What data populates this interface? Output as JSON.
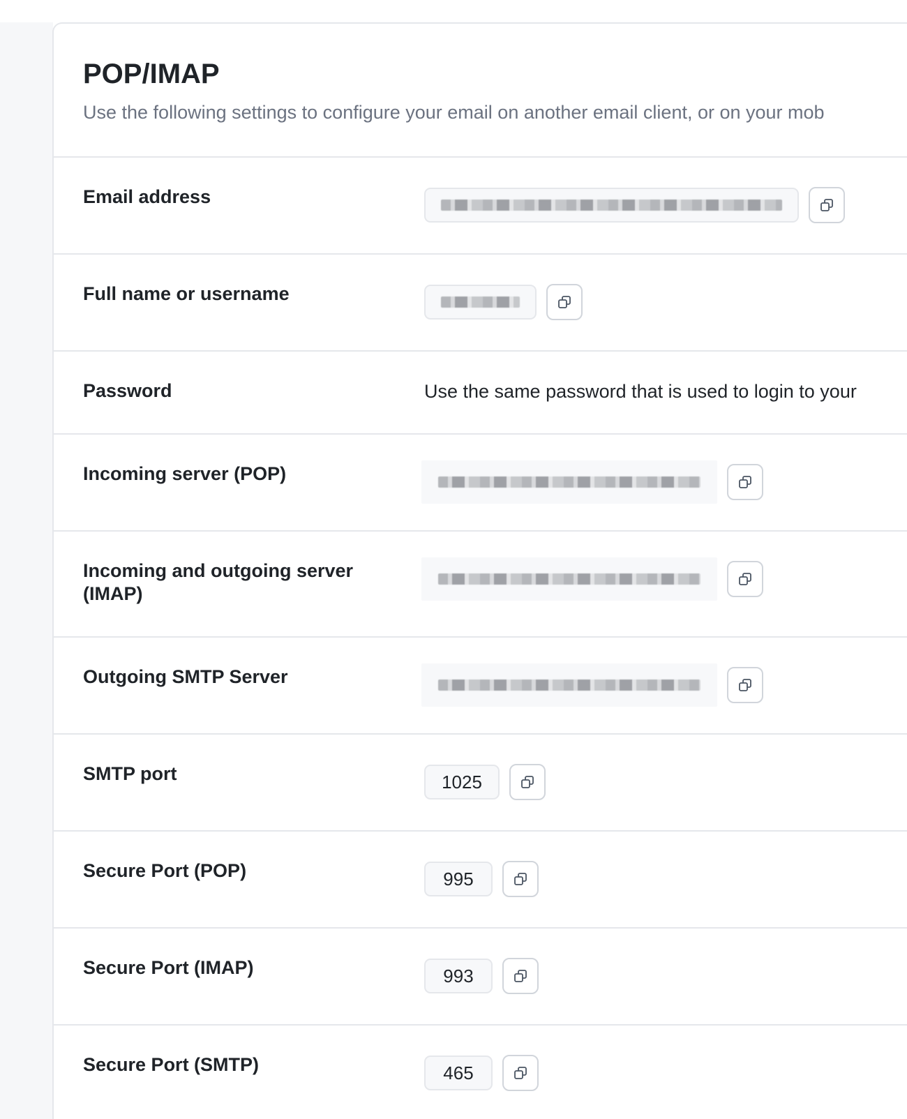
{
  "header": {
    "title": "POP/IMAP",
    "subtitle": "Use the following settings to configure your email on another email client, or on your mob"
  },
  "rows": {
    "email": {
      "label": "Email address",
      "value": ""
    },
    "fullname": {
      "label": "Full name or username",
      "value": ""
    },
    "password": {
      "label": "Password",
      "text": "Use the same password that is used to login to your"
    },
    "pop": {
      "label": "Incoming server (POP)",
      "value": ""
    },
    "imap": {
      "label": "Incoming and outgoing server (IMAP)",
      "value": ""
    },
    "smtp": {
      "label": "Outgoing SMTP Server",
      "value": ""
    },
    "smtp_port": {
      "label": "SMTP port",
      "value": "1025"
    },
    "secure_pop": {
      "label": "Secure Port (POP)",
      "value": "995"
    },
    "secure_imap": {
      "label": "Secure Port (IMAP)",
      "value": "993"
    },
    "secure_smtp": {
      "label": "Secure Port (SMTP)",
      "value": "465"
    }
  },
  "icons": {
    "copy": "copy-icon"
  },
  "colors": {
    "border": "#e5e7eb",
    "muted_text": "#6b7280",
    "field_bg": "#f7f8fa"
  }
}
